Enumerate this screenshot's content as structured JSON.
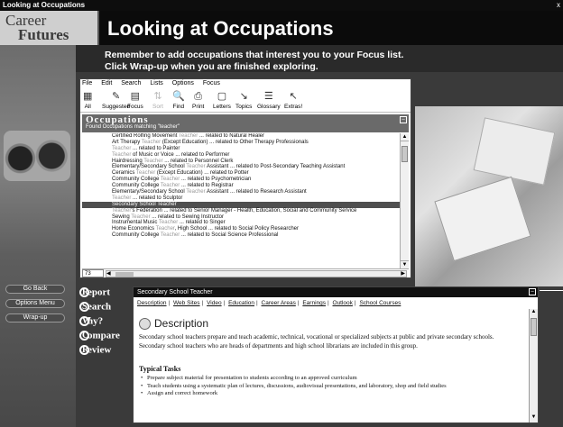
{
  "window_title": "Looking at Occupations",
  "close_glyph": "x",
  "brand": {
    "line1": "Career",
    "line2": "Futures"
  },
  "header_title": "Looking at Occupations",
  "instructions": "Remember to add occupations that interest you to your Focus list. Click Wrap-up when you are finished exploring.",
  "menu": [
    "File",
    "Edit",
    "Search",
    "Lists",
    "Options",
    "Focus"
  ],
  "toolbar": [
    {
      "label": "All",
      "icon": "all-icon",
      "glyph": "▦",
      "disabled": false
    },
    {
      "label": "Suggested",
      "icon": "suggested-icon",
      "glyph": "✎",
      "disabled": false
    },
    {
      "label": "Focus",
      "icon": "focus-icon",
      "glyph": "▤",
      "disabled": false
    },
    {
      "label": "Sort",
      "icon": "sort-icon",
      "glyph": "⇅",
      "disabled": true
    },
    {
      "label": "Find",
      "icon": "find-icon",
      "glyph": "🔍",
      "disabled": false
    },
    {
      "label": "Print",
      "icon": "print-icon",
      "glyph": "⎙",
      "disabled": false
    },
    {
      "label": "Letters",
      "icon": "letters-icon",
      "glyph": "▢",
      "disabled": false
    },
    {
      "label": "Topics",
      "icon": "topics-icon",
      "glyph": "↘",
      "disabled": false
    },
    {
      "label": "Glossary",
      "icon": "glossary-icon",
      "glyph": "☰",
      "disabled": false
    },
    {
      "label": "Extras!",
      "icon": "extras-icon",
      "glyph": "↖",
      "disabled": false
    }
  ],
  "occupations": {
    "title": "Occupations",
    "subtitle": "Found Occupations matching \"teacher\"",
    "count": "73",
    "rows": [
      {
        "pre": "Certified Rolfing Movement ",
        "kw": "Teacher",
        "post": " ... related to Natural Healer",
        "selected": false
      },
      {
        "pre": "Art Therapy ",
        "kw": "Teacher",
        "post": " (Except Education) ... related to Other Therapy Professionals",
        "selected": false
      },
      {
        "pre": "",
        "kw": "Teacher",
        "post": " ... related to Painter",
        "selected": false
      },
      {
        "pre": "",
        "kw": "Teacher",
        "post": " of Music or Voice ... related to Performer",
        "selected": false
      },
      {
        "pre": "Hairdressing ",
        "kw": "Teacher",
        "post": " ... related to Personnel Clerk",
        "selected": false
      },
      {
        "pre": "Elementary/Secondary School ",
        "kw": "Teacher",
        "post": " Assistant ... related to Post-Secondary Teaching Assistant",
        "selected": false
      },
      {
        "pre": "Ceramics ",
        "kw": "Teacher",
        "post": " (Except Education) ... related to Potter",
        "selected": false
      },
      {
        "pre": "Community College ",
        "kw": "Teacher",
        "post": " ... related to Psychometrician",
        "selected": false
      },
      {
        "pre": "Community College ",
        "kw": "Teacher",
        "post": " ... related to Registrar",
        "selected": false
      },
      {
        "pre": "Elementary/Secondary School ",
        "kw": "Teacher",
        "post": " Assistant ... related to Research Assistant",
        "selected": false
      },
      {
        "pre": "",
        "kw": "Teacher",
        "post": " ... related to Sculptor",
        "selected": false
      },
      {
        "pre": "Secondary School ",
        "kw": "Teacher",
        "post": "",
        "selected": true
      },
      {
        "pre": "",
        "kw": "Teacher",
        "post": "'s Federation ... related to Senior Manager - Health, Education, Social and Community Service",
        "selected": false
      },
      {
        "pre": "Sewing ",
        "kw": "Teacher",
        "post": " ... related to Sewing Instructor",
        "selected": false
      },
      {
        "pre": "Instrumental Music ",
        "kw": "Teacher",
        "post": " ... related to Singer",
        "selected": false
      },
      {
        "pre": "Home Economics ",
        "kw": "Teacher",
        "post": ", High School ... related to Social Policy Researcher",
        "selected": false
      },
      {
        "pre": "Community College ",
        "kw": "Teacher",
        "post": " ... related to Social Science Professional",
        "selected": false
      },
      {
        "pre": "",
        "kw": "",
        "post": "",
        "selected": false
      },
      {
        "pre": "",
        "kw": "",
        "post": "",
        "selected": false
      },
      {
        "pre": "",
        "kw": "",
        "post": "",
        "selected": false
      },
      {
        "pre": "",
        "kw": "",
        "post": "",
        "selected": false
      }
    ]
  },
  "left_nav": [
    "Go Back",
    "Options Menu",
    "Wrap-up"
  ],
  "actions": [
    {
      "letter": "R",
      "rest": "eport"
    },
    {
      "letter": "S",
      "rest": "earch"
    },
    {
      "letter": "W",
      "rest": "hy?"
    },
    {
      "letter": "C",
      "rest": "ompare"
    },
    {
      "letter": "R",
      "rest": "eview"
    }
  ],
  "detail": {
    "title": "Secondary School Teacher",
    "tabs": [
      "Description",
      "Web Sites",
      "Video",
      "Education",
      "Career Areas",
      "Earnings",
      "Outlook",
      "School Courses"
    ],
    "section": "Description",
    "body": "Secondary school teachers prepare and teach academic, technical, vocational or specialized subjects at public and private secondary schools. Secondary school teachers who are heads of departments and high school librarians are included in this group.",
    "tasks_heading": "Typical Tasks",
    "tasks": [
      "Prepare subject material for presentation to students according to an approved curriculum",
      "Teach students using a systematic plan of lectures, discussions, audiovisual presentations, and laboratory, shop and field studies",
      "Assign and correct homework"
    ]
  }
}
